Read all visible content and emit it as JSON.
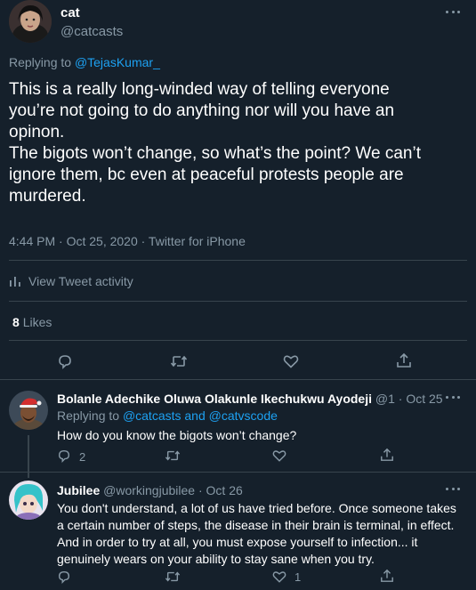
{
  "main_tweet": {
    "display_name": "cat",
    "handle": "@catcasts",
    "replying_prefix": "Replying to",
    "replying_to": "@TejasKumar_",
    "text_lines": [
      "This is a really long-winded way of telling everyone",
      "you’re not going to do anything nor will you have an",
      "opinon.",
      "The bigots won’t change, so what’s the point? We can’t",
      "ignore them, bc even at peaceful protests people are",
      "murdered."
    ],
    "meta": "4:44 PM · Oct 25, 2020 · Twitter for iPhone",
    "activity_label": "View Tweet activity",
    "likes_count": "8",
    "likes_label": "Likes"
  },
  "replies": [
    {
      "display_name": "Bolanle Adechike Oluwa Olakunle Ikechukwu Ayodeji",
      "handle": "@1",
      "date": "· Oct 25",
      "replying_prefix": "Replying to",
      "replying_to": "@catcasts and @catvscode",
      "text_lines": [
        "How do you know the bigots won’t change?"
      ],
      "reply_count": "2",
      "like_count": ""
    },
    {
      "display_name": "Jubilee",
      "handle": "@workingjubilee",
      "date": "· Oct 26",
      "text_lines": [
        "You don't understand, a lot of us have tried before. Once someone takes",
        "a certain number of steps, the disease in their brain is terminal, in effect.",
        "And in order to try at all, you must expose yourself to infection... it",
        "genuinely wears on your ability to stay sane when you try."
      ],
      "reply_count": "",
      "like_count": "1"
    }
  ],
  "colors": {
    "background": "#15202b",
    "text": "#ffffff",
    "muted": "#8899a6",
    "accent": "#1da1f2",
    "divider": "#38444d"
  }
}
